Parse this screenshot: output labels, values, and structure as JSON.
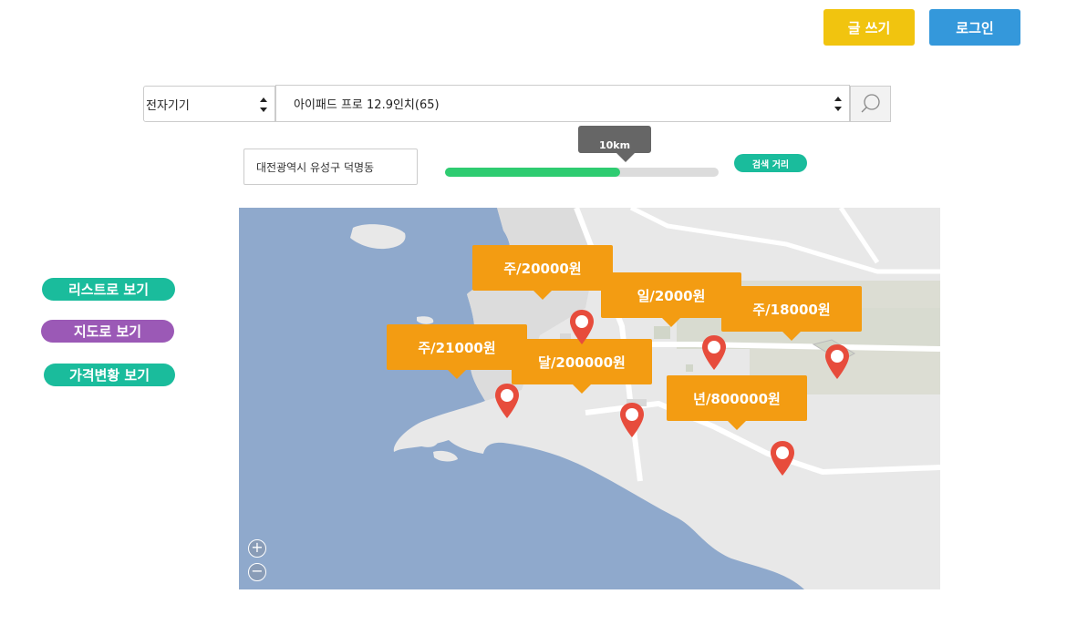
{
  "header": {
    "write_label": "글 쓰기",
    "login_label": "로그인"
  },
  "colors": {
    "write_button": "#f1c40f",
    "login_button": "#3498db",
    "list_button": "#1abc9c",
    "map_button": "#9b59b6",
    "price_button": "#1abc9c",
    "price_label": "#f39c12",
    "pin": "#e74c3c",
    "water": "#8fa9cc",
    "land": "#e8e8e8"
  },
  "search": {
    "category_value": "전자기기",
    "product_value": "아이패드 프로 12.9인치(65)",
    "search_icon": "search-icon"
  },
  "filter": {
    "location_value": "대전광역시 유성구 덕명동",
    "distance_tooltip": "10km",
    "distance_badge": "검색 거리",
    "distance_fraction": 0.64
  },
  "side_nav": {
    "list_view": "리스트로 보기",
    "map_view": "지도로 보기",
    "price_view": "가격변황 보기"
  },
  "map": {
    "labels": [
      "주/20000원",
      "일/2000원",
      "주/18000원",
      "주/21000원",
      "달/200000원",
      "년/800000원"
    ],
    "zoom_in": "+",
    "zoom_out": "−"
  }
}
